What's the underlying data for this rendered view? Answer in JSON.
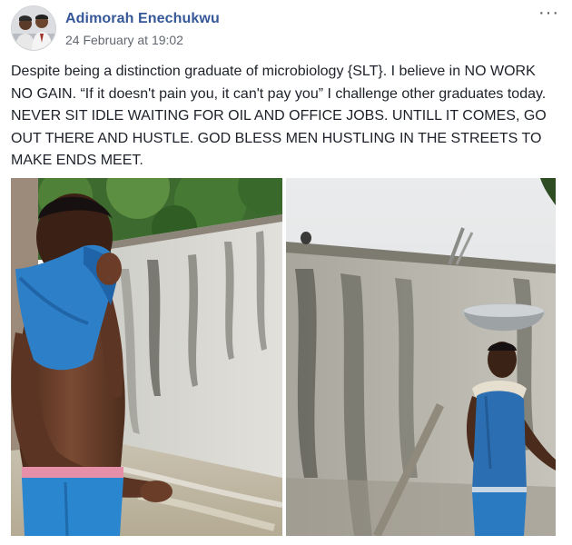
{
  "post": {
    "author": "Adimorah Enechukwu",
    "timestamp": "24 February at 19:02",
    "more_icon": "more-options-icon",
    "text": "Despite being a distinction graduate of microbiology {SLT}. I believe in NO WORK NO GAIN. “If it doesn't pain you, it can't pay you” I challenge other graduates today. NEVER SIT IDLE WAITING FOR OIL AND OFFICE JOBS. UNTILL IT COMES, GO OUT THERE AND HUSTLE. GOD BLESS MEN HUSTLING IN THE STREETS TO MAKE ENDS MEET."
  },
  "colors": {
    "author_link": "#365899",
    "meta_text": "#616770",
    "body_text": "#1d2129"
  }
}
